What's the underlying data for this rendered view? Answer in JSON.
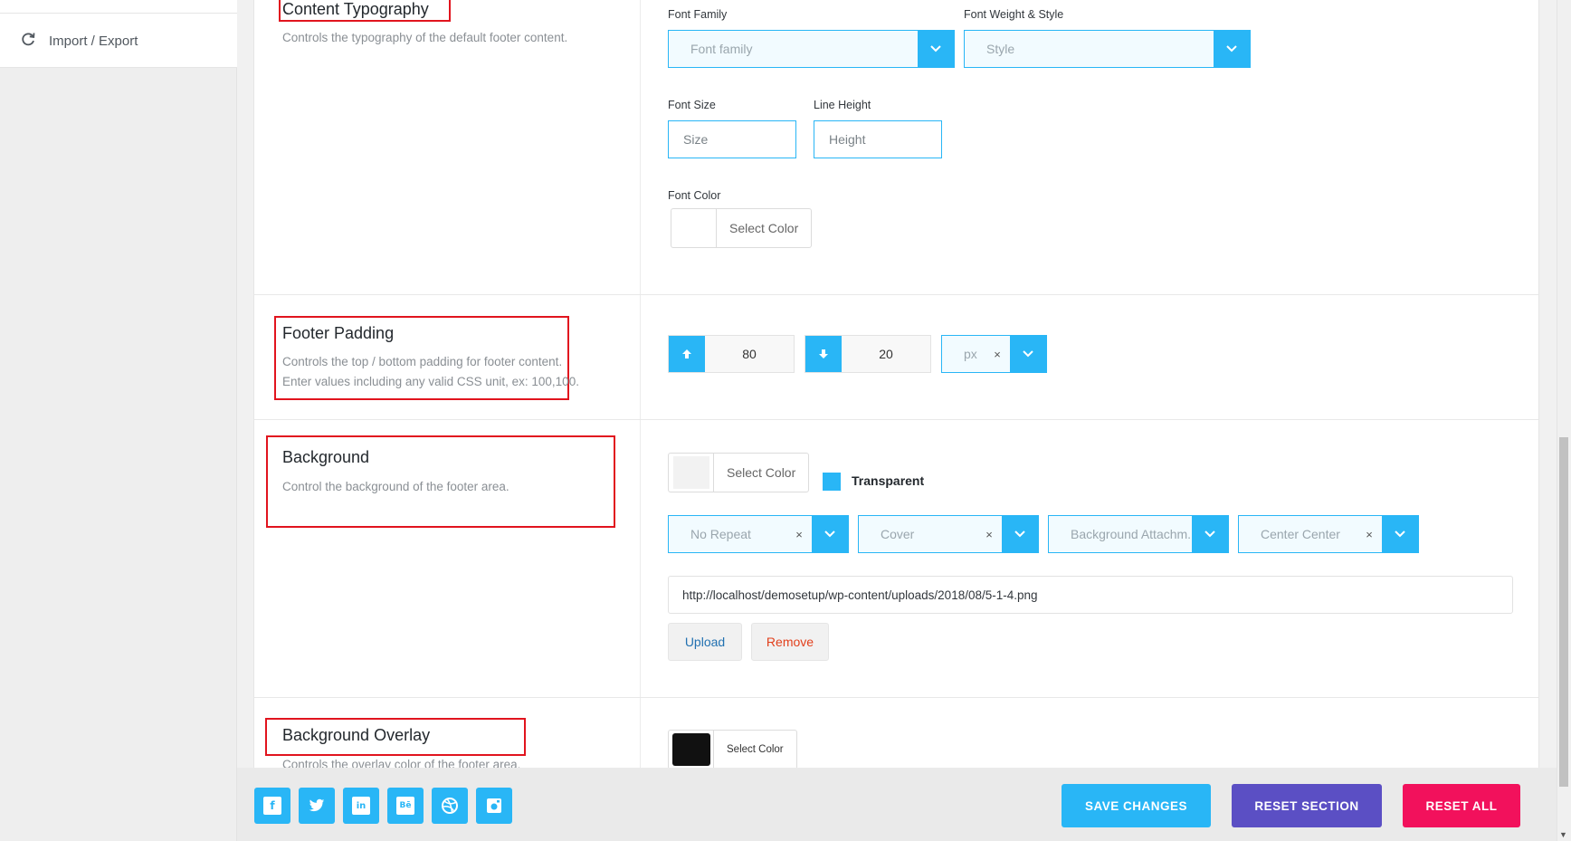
{
  "sidebar": {
    "items": [
      {
        "label": "Import / Export",
        "icon": "refresh-icon"
      }
    ]
  },
  "sections": {
    "content_typography": {
      "title": "Content Typography",
      "desc": "Controls the typography of the default footer content.",
      "font_family_label": "Font Family",
      "font_family_placeholder": "Font family",
      "font_weight_label": "Font Weight & Style",
      "font_weight_placeholder": "Style",
      "font_size_label": "Font Size",
      "font_size_placeholder": "Size",
      "line_height_label": "Line Height",
      "line_height_placeholder": "Height",
      "font_color_label": "Font Color",
      "font_color_button": "Select Color"
    },
    "footer_padding": {
      "title": "Footer Padding",
      "desc_line1": "Controls the top / bottom padding for footer content.",
      "desc_line2": "Enter values including any valid CSS unit, ex: 100,100.",
      "top_value": "80",
      "bottom_value": "20",
      "unit": "px"
    },
    "background": {
      "title": "Background",
      "desc": "Control the background of the footer area.",
      "color_button": "Select Color",
      "transparent_label": "Transparent",
      "repeat": "No Repeat",
      "size": "Cover",
      "attachment": "Background Attachm...",
      "position": "Center Center",
      "image_url": "http://localhost/demosetup/wp-content/uploads/2018/08/5-1-4.png",
      "upload_label": "Upload",
      "remove_label": "Remove"
    },
    "background_overlay": {
      "title": "Background Overlay",
      "desc": "Controls the overlay color of the footer area.",
      "color_button": "Select Color",
      "swatch_color": "#111111"
    }
  },
  "footer": {
    "social": [
      "facebook-icon",
      "twitter-icon",
      "linkedin-icon",
      "behance-icon",
      "dribbble-icon",
      "instagram-icon"
    ],
    "save_label": "SAVE CHANGES",
    "reset_section_label": "RESET SECTION",
    "reset_all_label": "RESET ALL"
  },
  "colors": {
    "accent": "#29b6f6",
    "reset_section": "#5b4fc4",
    "reset_all": "#f2115c",
    "highlight_box": "#e1141e"
  }
}
